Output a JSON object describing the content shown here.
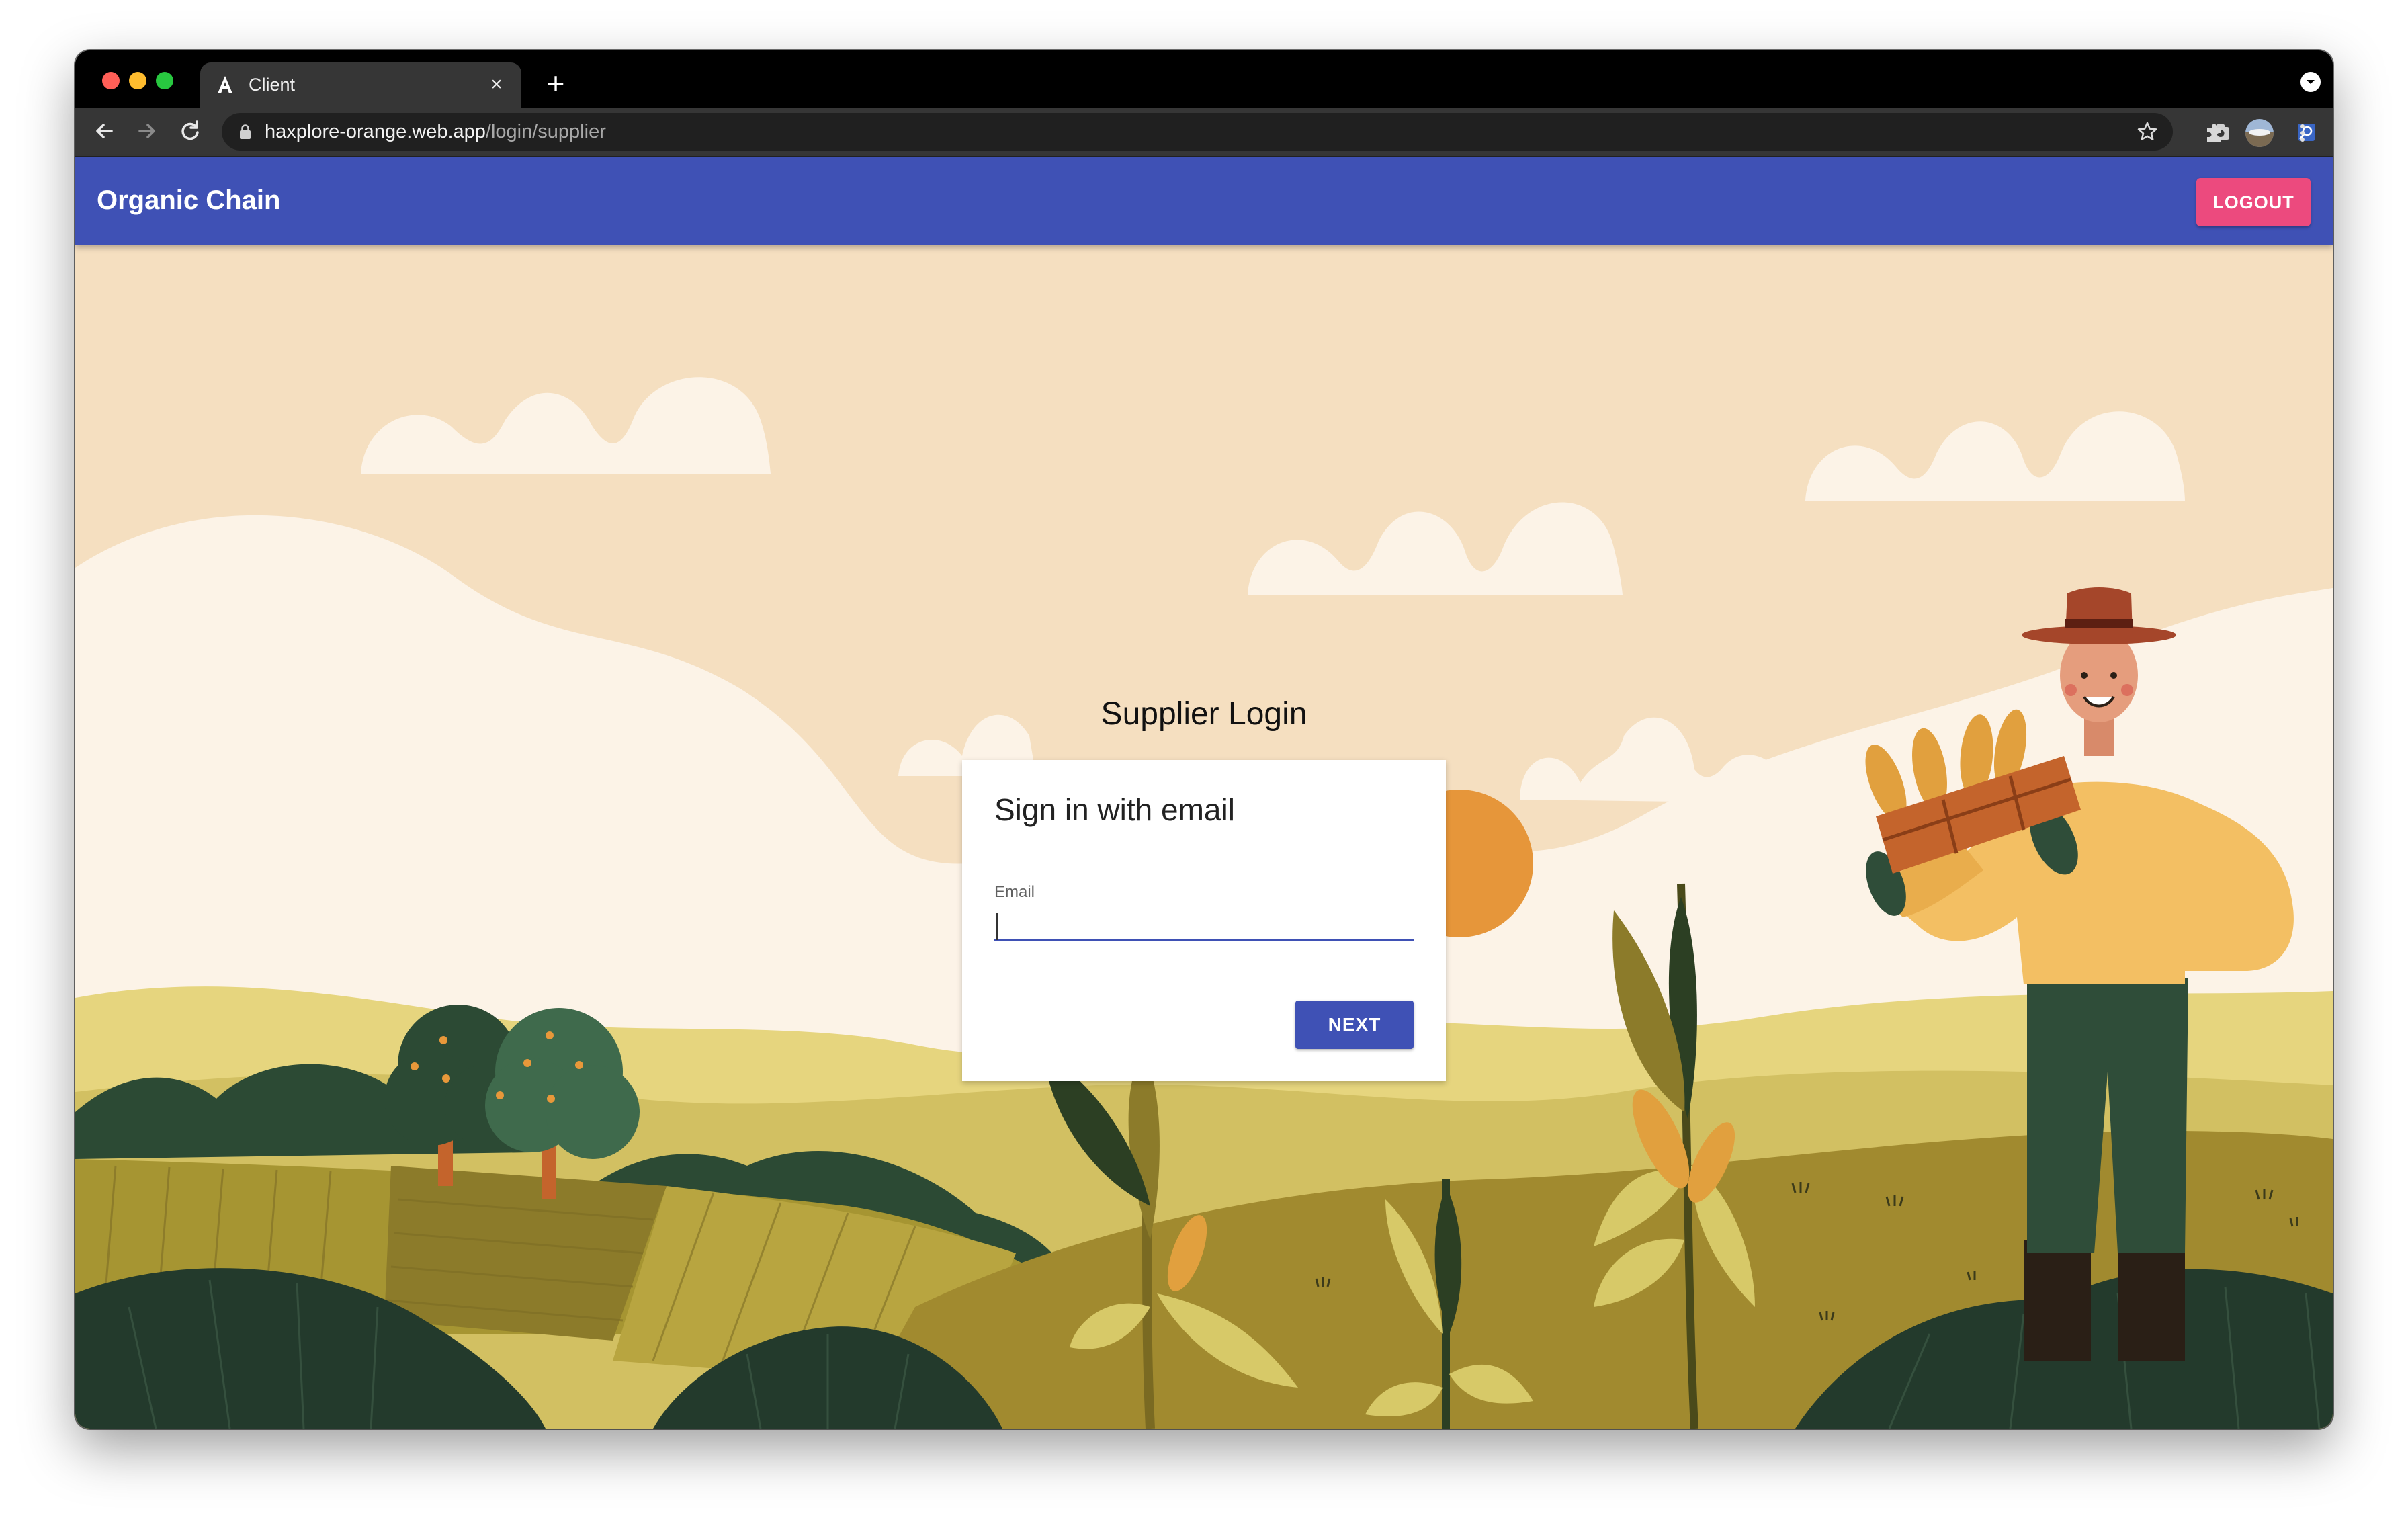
{
  "browser": {
    "tab_title": "Client",
    "url_host": "haxplore-orange.web.app",
    "url_path": "/login/supplier",
    "new_tab_symbol": "+",
    "close_symbol": "×"
  },
  "app": {
    "title": "Organic Chain",
    "logout_label": "LOGOUT"
  },
  "login": {
    "heading": "Supplier Login",
    "card_title": "Sign in with email",
    "email_label": "Email",
    "email_value": "",
    "next_label": "NEXT"
  },
  "colors": {
    "app_bar": "#3f51b5",
    "logout": "#ec4a7e",
    "next_button": "#3f51b5",
    "sky": "#f5dfc0",
    "field": "#a18a2f"
  },
  "icons": [
    "back-arrow-icon",
    "forward-arrow-icon",
    "reload-icon",
    "lock-icon",
    "star-icon",
    "camera-icon",
    "ublock-icon",
    "password-icon",
    "puzzle-icon",
    "profile-avatar-icon",
    "kebab-menu-icon"
  ]
}
